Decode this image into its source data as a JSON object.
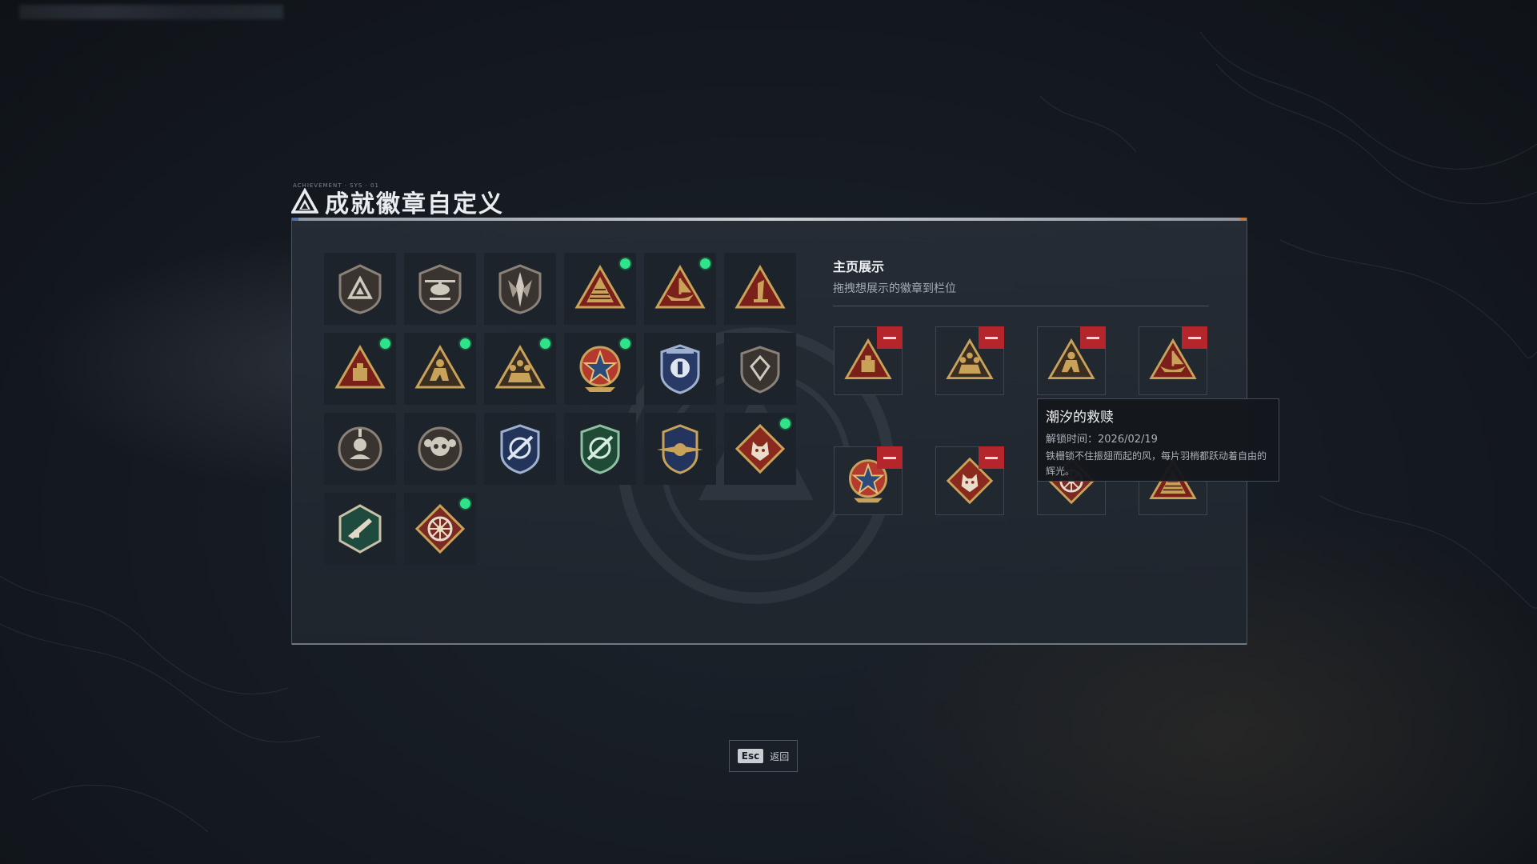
{
  "header": {
    "tiny_text": "ACHIEVEMENT · SYS · 01",
    "title": "成就徽章自定义",
    "logo_icon": "delta-triangle-logo-icon"
  },
  "badges": [
    {
      "icon": "shield-triangle-icon",
      "new": false
    },
    {
      "icon": "helicopter-shield-icon",
      "new": false
    },
    {
      "icon": "spear-shield-icon",
      "new": false
    },
    {
      "icon": "pyramid-gold-icon",
      "new": true
    },
    {
      "icon": "ship-triangle-icon",
      "new": true
    },
    {
      "icon": "number-one-triangle-icon",
      "new": false
    },
    {
      "icon": "box-triangle-icon",
      "new": true
    },
    {
      "icon": "kneeling-soldier-triangle-icon",
      "new": true
    },
    {
      "icon": "squad-triangle-icon",
      "new": true
    },
    {
      "icon": "star-medal-icon",
      "new": true
    },
    {
      "icon": "blue-crest-icon",
      "new": false
    },
    {
      "icon": "diamond-shield-icon",
      "new": false
    },
    {
      "icon": "soldier-round-icon",
      "new": false
    },
    {
      "icon": "skull-round-icon",
      "new": false
    },
    {
      "icon": "blue-crosshair-shield-icon",
      "new": false
    },
    {
      "icon": "green-crosshair-shield-icon",
      "new": false
    },
    {
      "icon": "gold-wing-shield-icon",
      "new": false
    },
    {
      "icon": "wolf-diamond-icon",
      "new": true
    },
    {
      "icon": "rifle-hexagon-icon",
      "new": false
    },
    {
      "icon": "wheel-diamond-icon",
      "new": true
    }
  ],
  "showcase": {
    "title": "主页展示",
    "subtitle": "拖拽想展示的徽章到栏位",
    "slots": [
      {
        "icon": "box-triangle-icon",
        "removable": true
      },
      {
        "icon": "squad-triangle-icon",
        "removable": true
      },
      {
        "icon": "kneeling-soldier-triangle-icon",
        "removable": true
      },
      {
        "icon": "ship-triangle-icon",
        "removable": true
      },
      {
        "icon": "star-medal-icon",
        "removable": true
      },
      {
        "icon": "wolf-diamond-icon",
        "removable": true
      },
      {
        "icon": "wheel-diamond-icon",
        "removable": false
      },
      {
        "icon": "pyramid-gold-icon",
        "removable": false
      }
    ],
    "remove_icon": "minus-icon"
  },
  "tooltip": {
    "name": "潮汐的救赎",
    "unlock_label": "解锁时间：",
    "unlock_date": "2026/02/19",
    "description": "铁栅锁不住振翅而起的风，每片羽梢都跃动着自由的辉光。"
  },
  "footer": {
    "key": "Esc",
    "label": "返回"
  },
  "colors": {
    "new_dot": "#2fe38a",
    "remove": "#b4262b",
    "gold": "#c9a25a",
    "badge_red": "#7a1f1a"
  }
}
